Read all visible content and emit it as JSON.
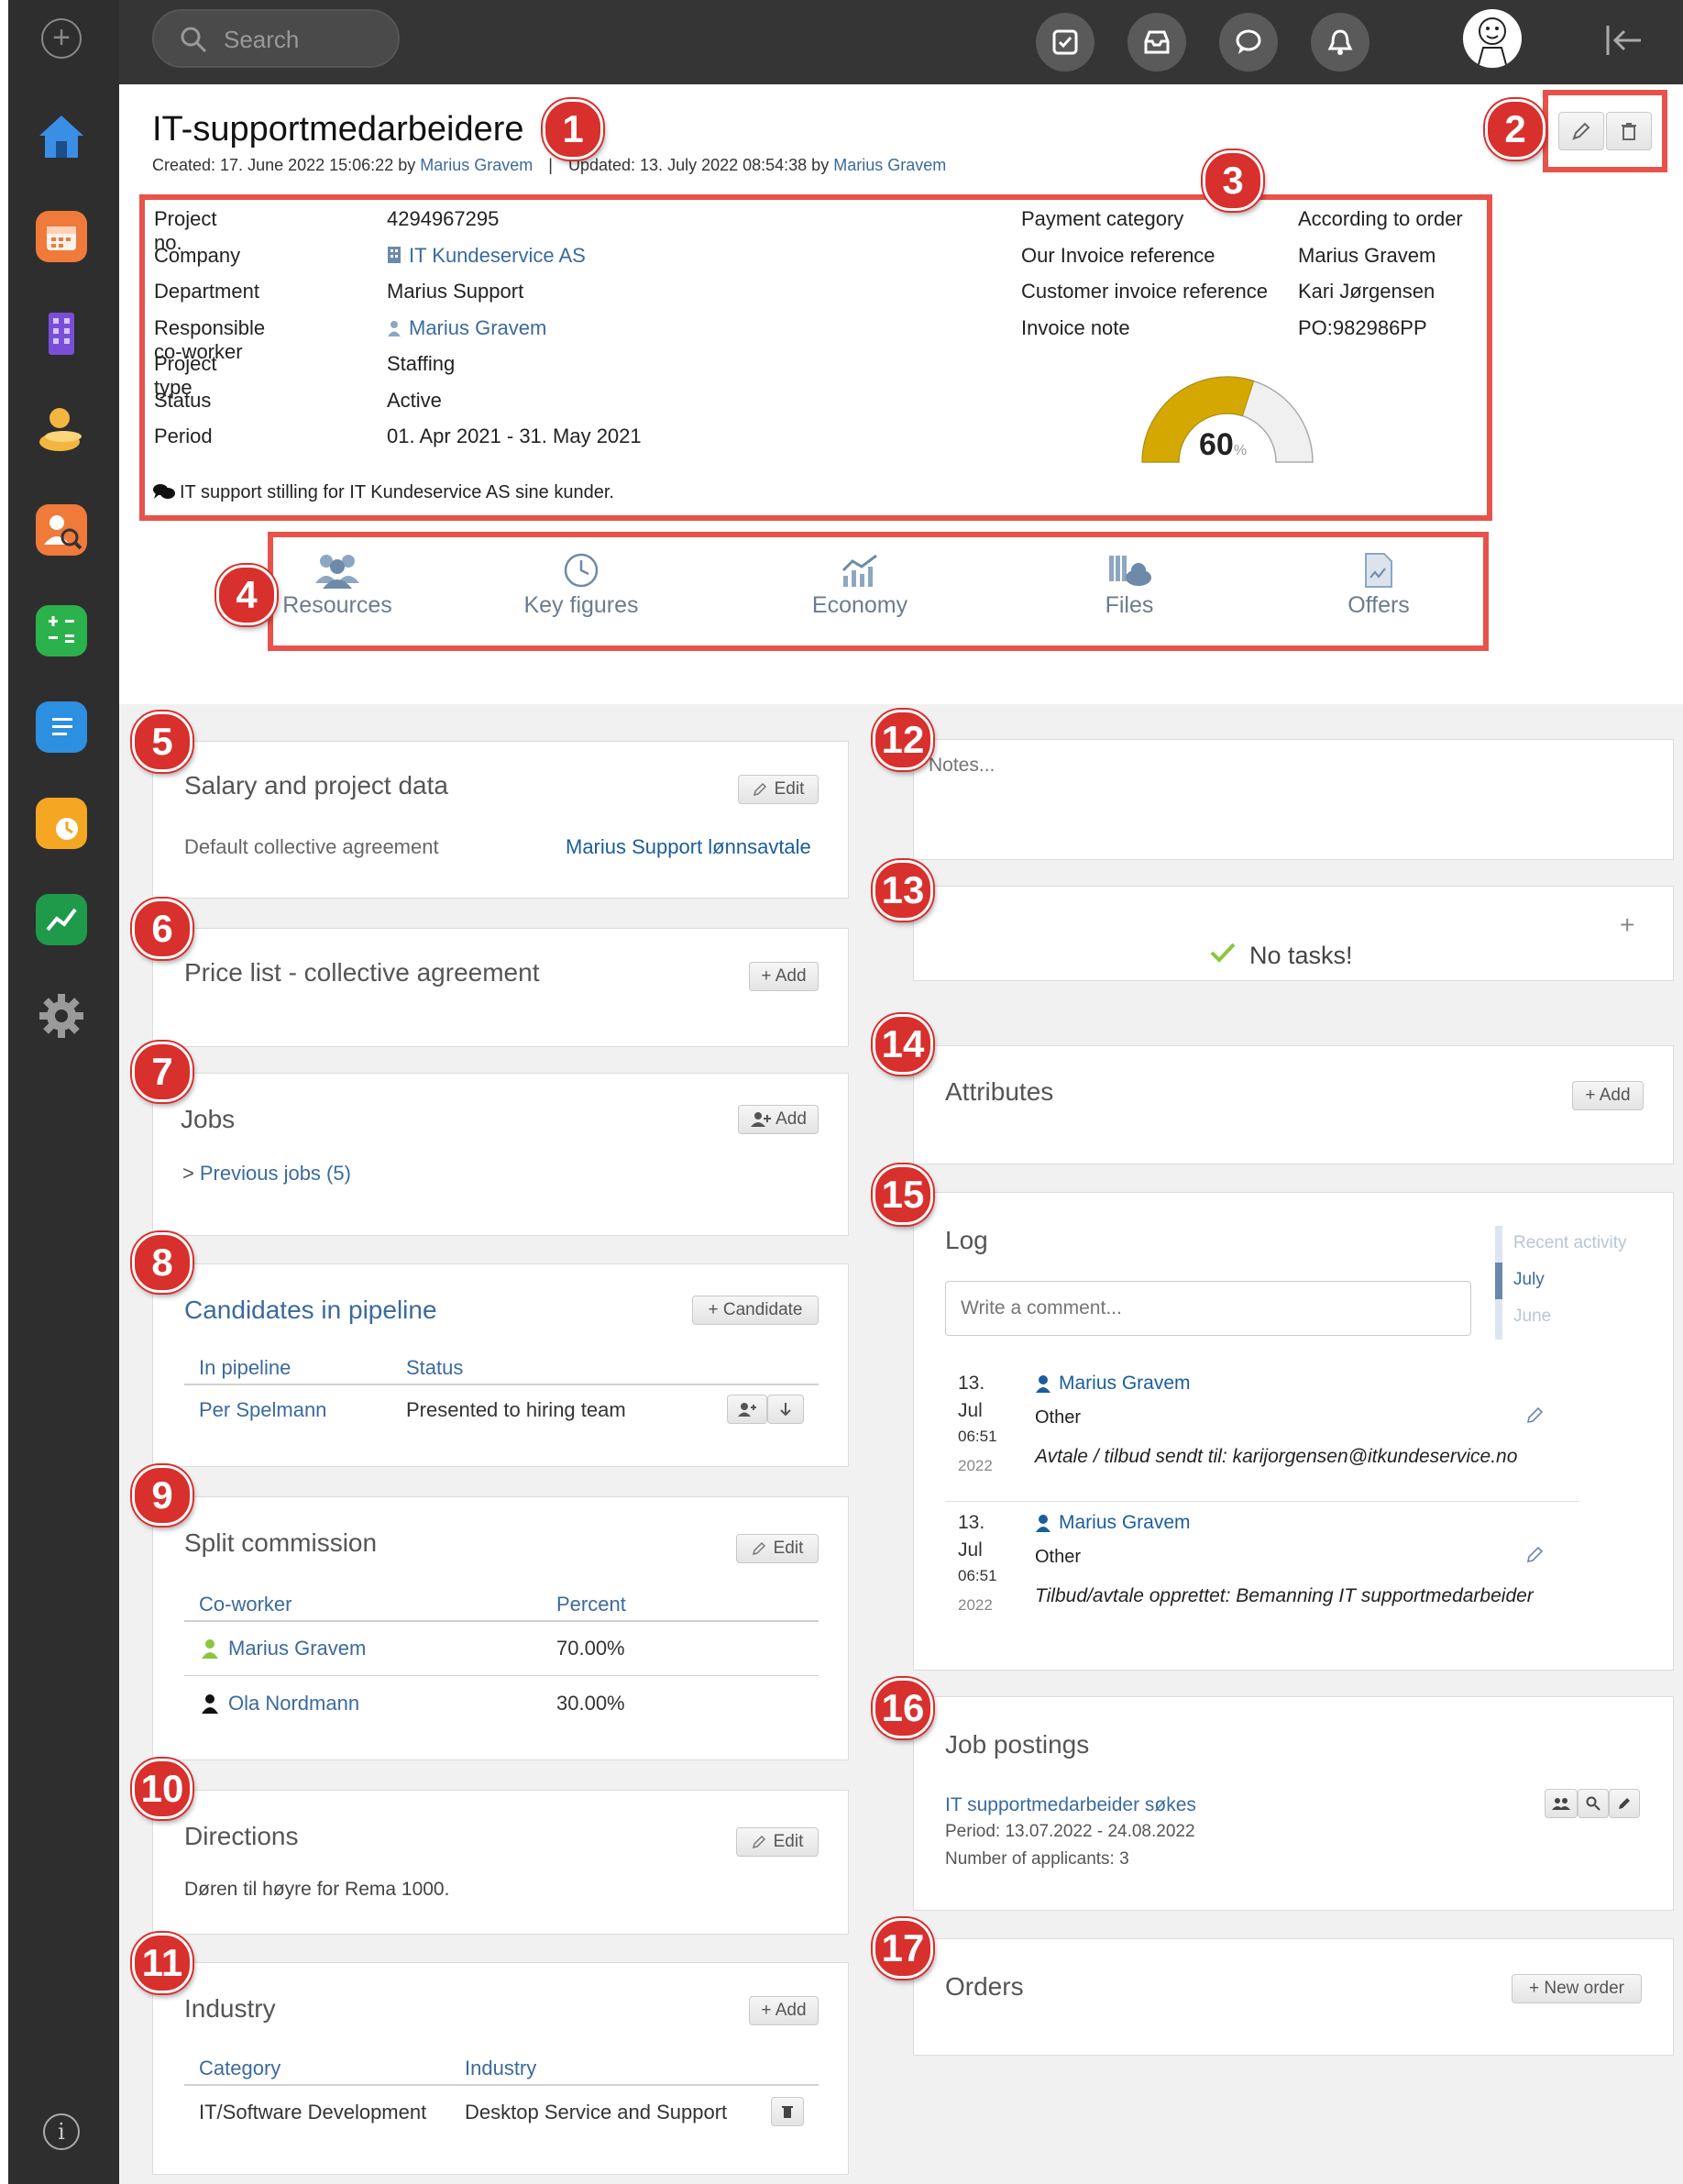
{
  "search": {
    "placeholder": "Search"
  },
  "page": {
    "title": "IT-supportmedarbeidere",
    "created_prefix": "Created: 17. June 2022 15:06:22 by",
    "created_by": "Marius Gravem",
    "separator": "|",
    "updated_prefix": "Updated: 13. July 2022 08:54:38 by",
    "updated_by": "Marius Gravem"
  },
  "details": {
    "left": [
      {
        "label": "Project no.",
        "value": "4294967295"
      },
      {
        "label": "Company",
        "value": "IT Kundeservice AS"
      },
      {
        "label": "Department",
        "value": "Marius Support"
      },
      {
        "label": "Responsible co-worker",
        "value": "Marius Gravem"
      },
      {
        "label": "Project type",
        "value": "Staffing"
      },
      {
        "label": "Status",
        "value": "Active"
      },
      {
        "label": "Period",
        "value": "01. Apr 2021 - 31. May 2021"
      }
    ],
    "right": [
      {
        "label": "Payment category",
        "value": "According to order"
      },
      {
        "label": "Our Invoice reference",
        "value": "Marius Gravem"
      },
      {
        "label": "Customer invoice reference",
        "value": "Kari Jørgensen"
      },
      {
        "label": "Invoice note",
        "value": "PO:982986PP"
      }
    ],
    "gauge": {
      "value": 60,
      "label": "60",
      "unit": "%",
      "fill_color": "#d4a800"
    },
    "description": "IT support stilling for IT Kundeservice AS sine kunder."
  },
  "tabs": [
    {
      "label": "Resources",
      "icon": "people-icon"
    },
    {
      "label": "Key figures",
      "icon": "clock-icon"
    },
    {
      "label": "Economy",
      "icon": "chart-icon"
    },
    {
      "label": "Files",
      "icon": "files-cloud-icon"
    },
    {
      "label": "Offers",
      "icon": "document-icon"
    }
  ],
  "badges": [
    "1",
    "2",
    "3",
    "4",
    "5",
    "6",
    "7",
    "8",
    "9",
    "10",
    "11",
    "12",
    "13",
    "14",
    "15",
    "16",
    "17"
  ],
  "salary": {
    "title": "Salary and project data",
    "edit": "Edit",
    "label": "Default collective agreement",
    "value": "Marius Support lønnsavtale"
  },
  "pricelist": {
    "title": "Price list - collective agreement",
    "add": "+ Add"
  },
  "jobs": {
    "title": "Jobs",
    "add": "Add",
    "previous": "Previous jobs (5)"
  },
  "candidates": {
    "title": "Candidates in pipeline",
    "add": "+ Candidate",
    "headers": [
      "In pipeline",
      "Status"
    ],
    "rows": [
      {
        "name": "Per Spelmann",
        "status": "Presented to hiring team"
      }
    ]
  },
  "split": {
    "title": "Split commission",
    "edit": "Edit",
    "headers": [
      "Co-worker",
      "Percent"
    ],
    "rows": [
      {
        "name": "Marius Gravem",
        "percent": "70.00%",
        "icon_color": "#8cc63f"
      },
      {
        "name": "Ola Nordmann",
        "percent": "30.00%",
        "icon_color": "#111111"
      }
    ]
  },
  "directions": {
    "title": "Directions",
    "edit": "Edit",
    "text": "Døren til høyre for Rema 1000."
  },
  "industry": {
    "title": "Industry",
    "add": "+ Add",
    "headers": [
      "Category",
      "Industry"
    ],
    "rows": [
      {
        "category": "IT/Software Development",
        "industry": "Desktop Service and Support"
      }
    ]
  },
  "notes": {
    "placeholder": "Notes..."
  },
  "tasks": {
    "empty": "No tasks!",
    "add": "+"
  },
  "attributes": {
    "title": "Attributes",
    "add": "+ Add"
  },
  "log": {
    "title": "Log",
    "comment_placeholder": "Write a comment...",
    "timeline": [
      "Recent activity",
      "July",
      "June"
    ],
    "entries": [
      {
        "day": "13.",
        "month": "Jul",
        "time": "06:51",
        "year": "2022",
        "user": "Marius Gravem",
        "type": "Other",
        "text": "Avtale / tilbud sendt til: karijorgensen@itkundeservice.no"
      },
      {
        "day": "13.",
        "month": "Jul",
        "time": "06:51",
        "year": "2022",
        "user": "Marius Gravem",
        "type": "Other",
        "text": "Tilbud/avtale opprettet: Bemanning IT supportmedarbeider"
      }
    ]
  },
  "postings": {
    "title": "Job postings",
    "item_title": "IT supportmedarbeider søkes",
    "period": "Period: 13.07.2022 - 24.08.2022",
    "applicants": "Number of applicants: 3"
  },
  "orders": {
    "title": "Orders",
    "add": "+ New order"
  },
  "colors": {
    "accent_red": "#e8524a",
    "link_blue": "#3b6a9e",
    "badge_red": "#d8302d"
  }
}
